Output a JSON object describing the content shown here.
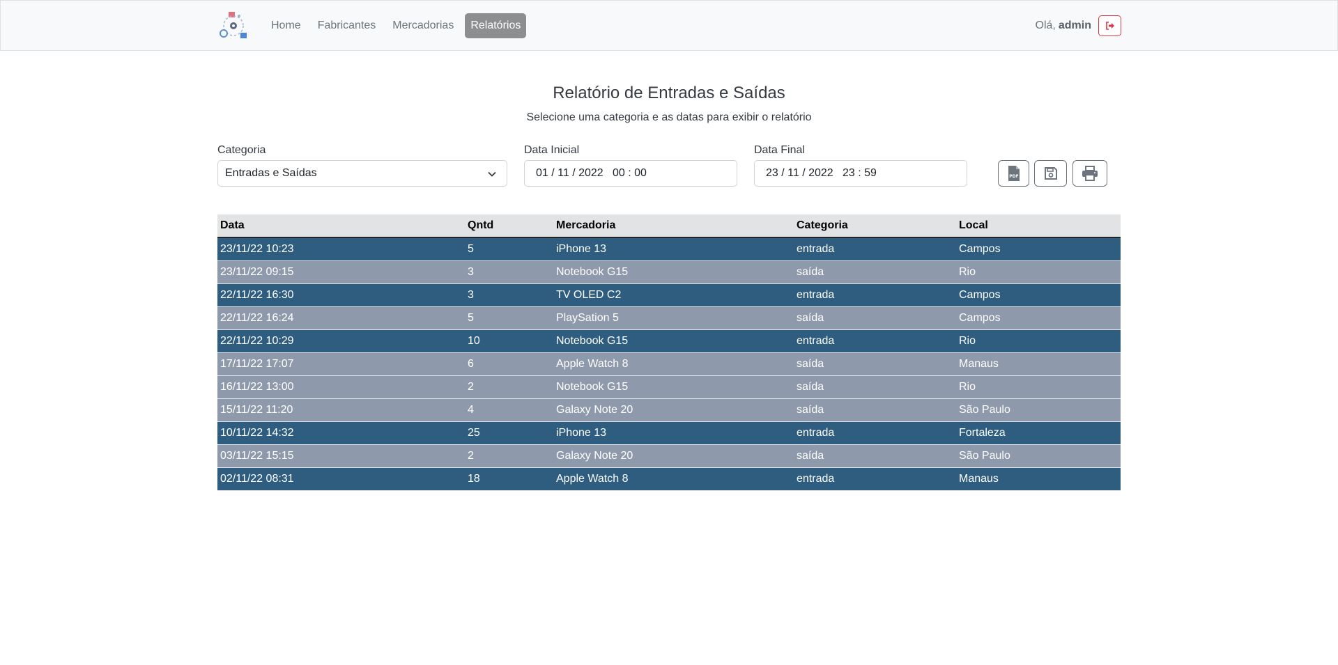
{
  "nav": {
    "items": [
      {
        "label": "Home",
        "active": false
      },
      {
        "label": "Fabricantes",
        "active": false
      },
      {
        "label": "Mercadorias",
        "active": false
      },
      {
        "label": "Relatórios",
        "active": true
      }
    ],
    "greeting": "Olá,",
    "user": "admin"
  },
  "header": {
    "title": "Relatório de Entradas e Saídas",
    "subtitle": "Selecione uma categoria e as datas para exibir o relatório"
  },
  "filters": {
    "categoria_label": "Categoria",
    "categoria_value": "Entradas e Saídas",
    "data_inicial_label": "Data Inicial",
    "data_inicial_value": "01 / 11 / 2022   00 : 00",
    "data_final_label": "Data Final",
    "data_final_value": "23 / 11 / 2022   23 : 59"
  },
  "table": {
    "columns": [
      "Data",
      "Qntd",
      "Mercadoria",
      "Categoria",
      "Local"
    ],
    "rows": [
      {
        "data": "23/11/22 10:23",
        "qntd": "5",
        "mercadoria": "iPhone 13",
        "categoria": "entrada",
        "local": "Campos"
      },
      {
        "data": "23/11/22 09:15",
        "qntd": "3",
        "mercadoria": "Notebook G15",
        "categoria": "saída",
        "local": "Rio"
      },
      {
        "data": "22/11/22 16:30",
        "qntd": "3",
        "mercadoria": "TV OLED C2",
        "categoria": "entrada",
        "local": "Campos"
      },
      {
        "data": "22/11/22 16:24",
        "qntd": "5",
        "mercadoria": "PlaySation 5",
        "categoria": "saída",
        "local": "Campos"
      },
      {
        "data": "22/11/22 10:29",
        "qntd": "10",
        "mercadoria": "Notebook G15",
        "categoria": "entrada",
        "local": "Rio"
      },
      {
        "data": "17/11/22 17:07",
        "qntd": "6",
        "mercadoria": "Apple Watch 8",
        "categoria": "saída",
        "local": "Manaus"
      },
      {
        "data": "16/11/22 13:00",
        "qntd": "2",
        "mercadoria": "Notebook G15",
        "categoria": "saída",
        "local": "Rio"
      },
      {
        "data": "15/11/22 11:20",
        "qntd": "4",
        "mercadoria": "Galaxy Note 20",
        "categoria": "saída",
        "local": "São Paulo"
      },
      {
        "data": "10/11/22 14:32",
        "qntd": "25",
        "mercadoria": "iPhone 13",
        "categoria": "entrada",
        "local": "Fortaleza"
      },
      {
        "data": "03/11/22 15:15",
        "qntd": "2",
        "mercadoria": "Galaxy Note 20",
        "categoria": "saída",
        "local": "São Paulo"
      },
      {
        "data": "02/11/22 08:31",
        "qntd": "18",
        "mercadoria": "Apple Watch 8",
        "categoria": "entrada",
        "local": "Manaus"
      }
    ]
  },
  "colors": {
    "entrada_row": "#2e5d80",
    "saida_row": "#8e9aab",
    "header_row": "#e2e3e5",
    "logout_accent": "#dc3545"
  },
  "icons": {
    "logo": "app-logo-icon",
    "logout": "sign-out-icon",
    "select": "chevron-down-icon",
    "pdf": "pdf-file-icon",
    "save": "floppy-disk-icon",
    "print": "printer-icon"
  }
}
